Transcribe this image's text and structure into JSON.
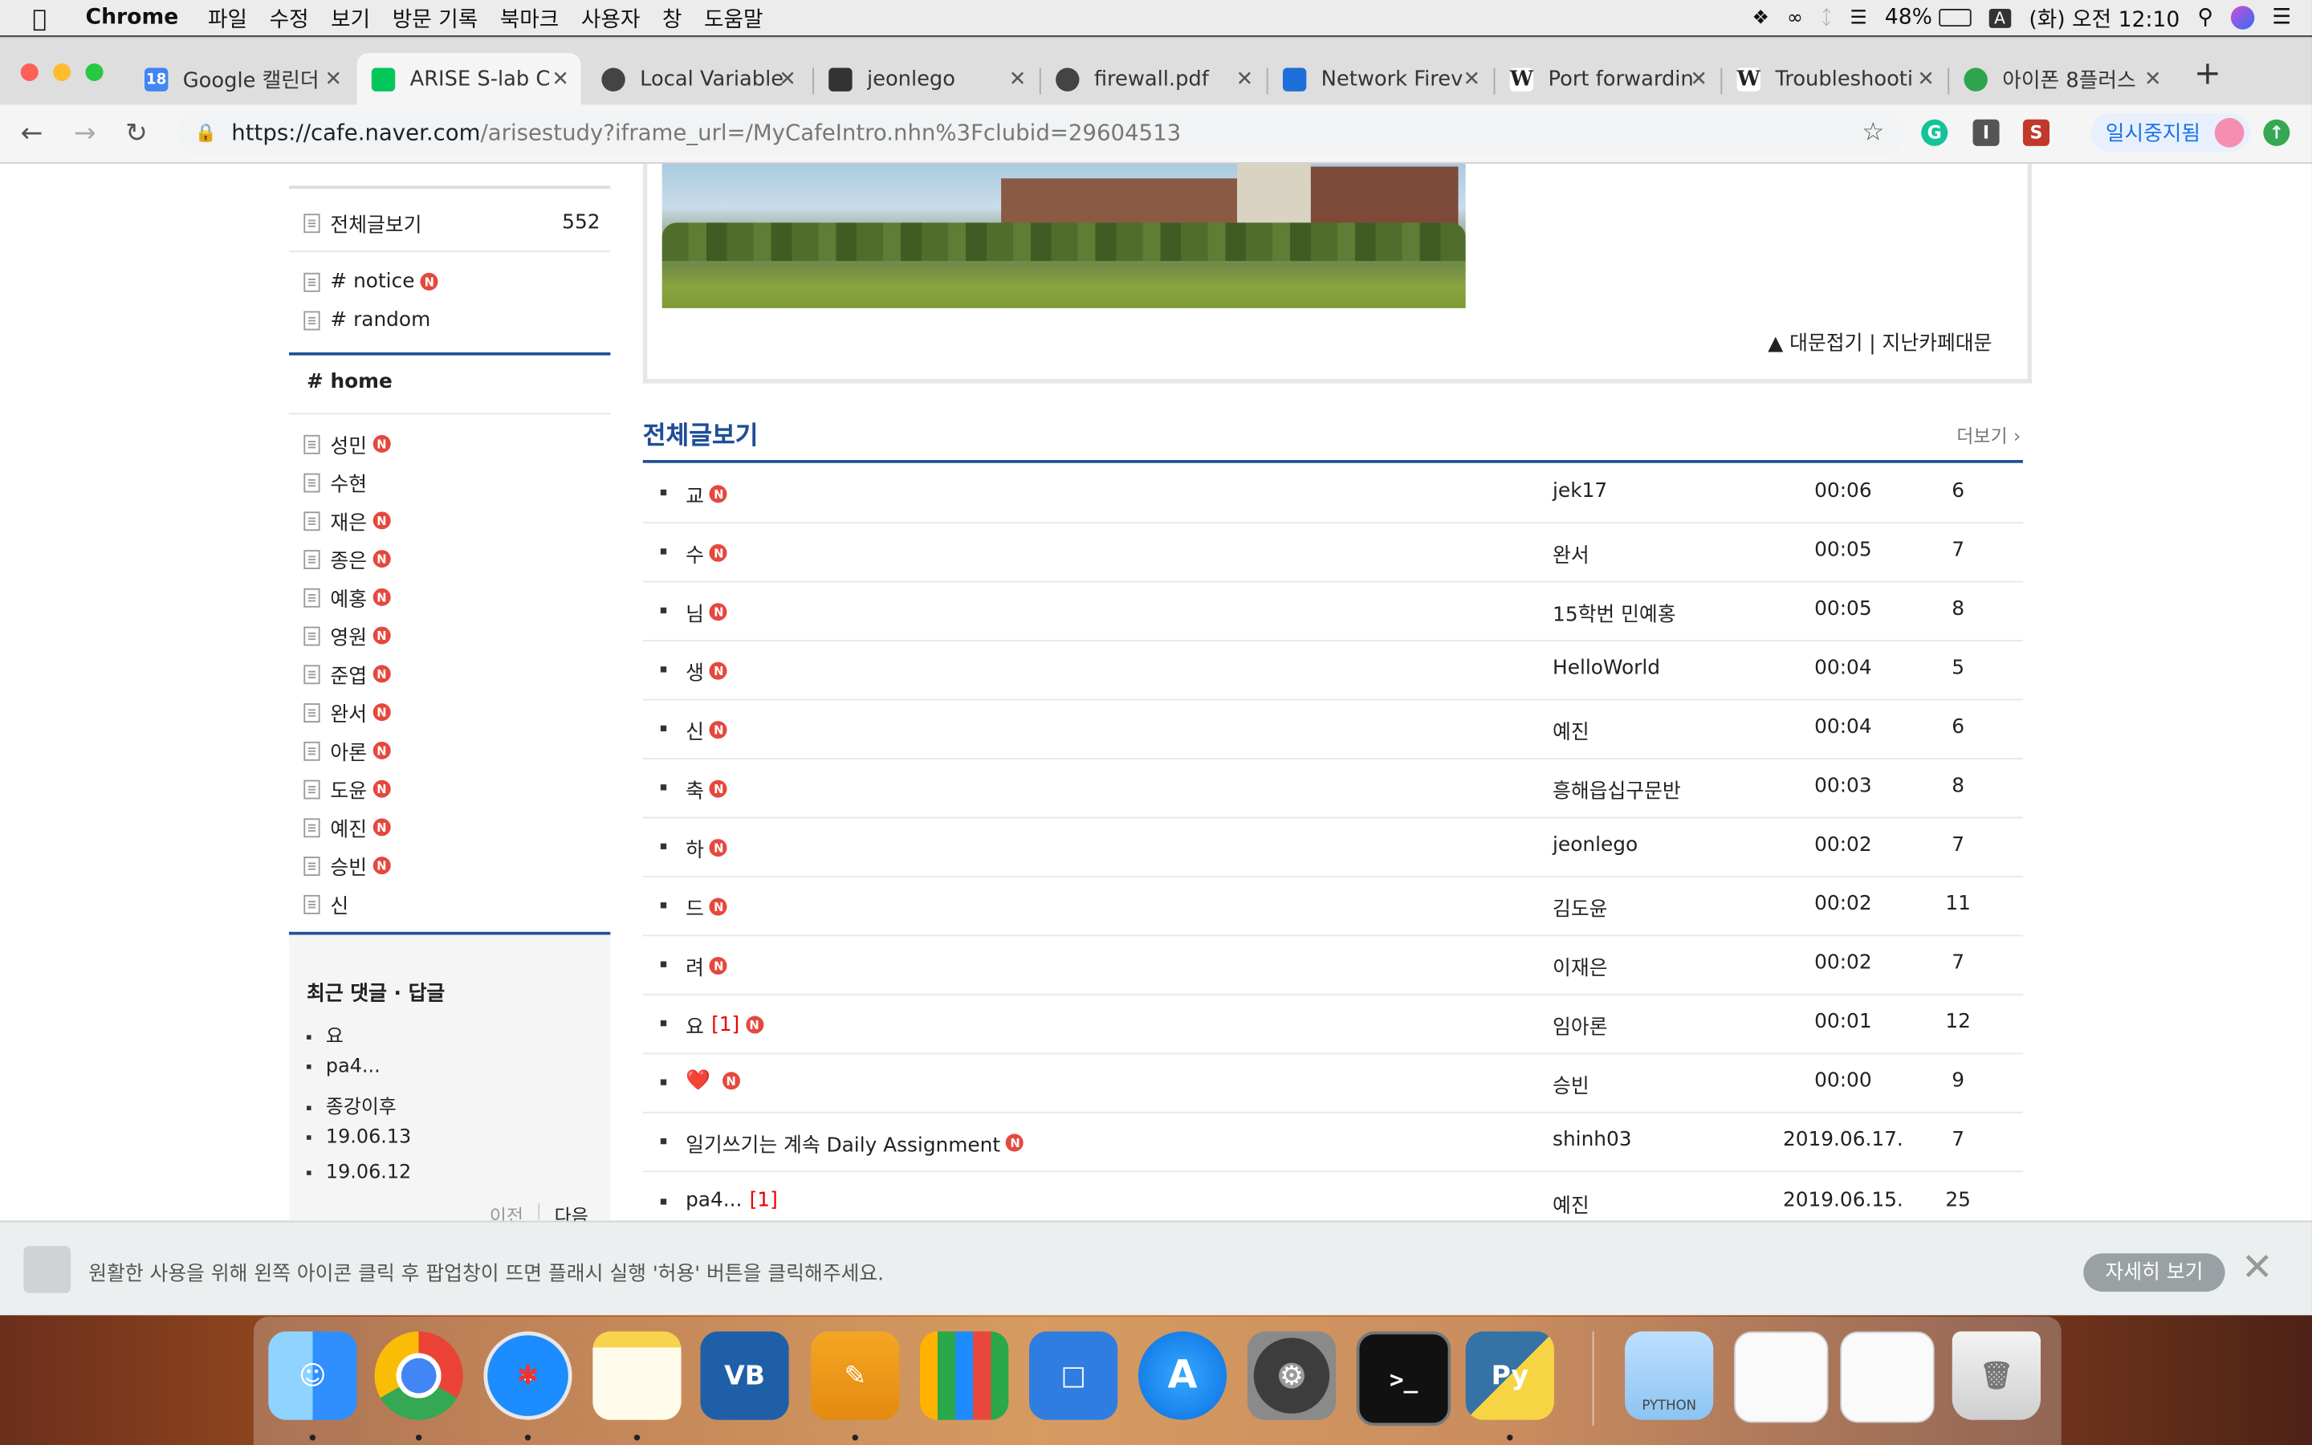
{
  "menubar": {
    "app": "Chrome",
    "items": [
      "파일",
      "수정",
      "보기",
      "방문 기록",
      "북마크",
      "사용자",
      "창",
      "도움말"
    ],
    "battery": "48%",
    "input_source": "A",
    "clock": "(화) 오전 12:10"
  },
  "tabs": [
    {
      "title": "Google 캘린더",
      "favicon_text": "18",
      "color": "#4285f4"
    },
    {
      "title": "ARISE S-lab C",
      "favicon_text": "",
      "color": "#03c75a"
    },
    {
      "title": "Local Variable",
      "favicon_text": "",
      "color": "#444444"
    },
    {
      "title": "jeonlego",
      "favicon_text": "",
      "color": "#333333"
    },
    {
      "title": "firewall.pdf",
      "favicon_text": "",
      "color": "#444444"
    },
    {
      "title": "Network Firev",
      "favicon_text": "",
      "color": "#1e6fd9"
    },
    {
      "title": "Port forwardin",
      "favicon_text": "W",
      "color": "#222222"
    },
    {
      "title": "Troubleshooti",
      "favicon_text": "W",
      "color": "#222222"
    },
    {
      "title": "아이폰 8플러스",
      "favicon_text": "",
      "color": "#2ea44f"
    }
  ],
  "address": {
    "domain": "https://cafe.naver.com",
    "path": "/arisestudy?iframe_url=/MyCafeIntro.nhn%3Fclubid=29604513"
  },
  "extensions": [
    "G",
    "I",
    "S"
  ],
  "pause_label": "일시중지됨",
  "sidebar": {
    "all_posts_label": "전체글보기",
    "all_posts_count": "552",
    "boards": [
      "# notice",
      "# random"
    ],
    "home_label": "# home",
    "members": [
      {
        "name": "성민",
        "new": true
      },
      {
        "name": "수현",
        "new": false
      },
      {
        "name": "재은",
        "new": true
      },
      {
        "name": "종은",
        "new": true
      },
      {
        "name": "예홍",
        "new": true
      },
      {
        "name": "영원",
        "new": true
      },
      {
        "name": "준엽",
        "new": true
      },
      {
        "name": "완서",
        "new": true
      },
      {
        "name": "아론",
        "new": true
      },
      {
        "name": "도윤",
        "new": true
      },
      {
        "name": "예진",
        "new": true
      },
      {
        "name": "승빈",
        "new": true
      },
      {
        "name": "신",
        "new": false
      }
    ],
    "recent_title": "최근 댓글 · 답글",
    "recent": [
      "요",
      "pa4...",
      "종강이후",
      "19.06.13",
      "19.06.12"
    ],
    "prev": "이전",
    "next": "다음"
  },
  "banner_links": "▲ 대문접기 | 지난카페대문",
  "posts_section": {
    "title": "전체글보기",
    "more": "더보기",
    "new_badge": "N",
    "rows": [
      {
        "title": "교",
        "comments": "",
        "new": true,
        "author": "jek17",
        "time": "00:06",
        "views": "6"
      },
      {
        "title": "수",
        "comments": "",
        "new": true,
        "author": "완서",
        "time": "00:05",
        "views": "7"
      },
      {
        "title": "님",
        "comments": "",
        "new": true,
        "author": "15학번 민예홍",
        "time": "00:05",
        "views": "8"
      },
      {
        "title": "생",
        "comments": "",
        "new": true,
        "author": "HelloWorld",
        "time": "00:04",
        "views": "5"
      },
      {
        "title": "신",
        "comments": "",
        "new": true,
        "author": "예진",
        "time": "00:04",
        "views": "6"
      },
      {
        "title": "축",
        "comments": "",
        "new": true,
        "author": "흥해읍십구문반",
        "time": "00:03",
        "views": "8"
      },
      {
        "title": "하",
        "comments": "",
        "new": true,
        "author": "jeonlego",
        "time": "00:02",
        "views": "7"
      },
      {
        "title": "드",
        "comments": "",
        "new": true,
        "author": "김도윤",
        "time": "00:02",
        "views": "11"
      },
      {
        "title": "려",
        "comments": "",
        "new": true,
        "author": "이재은",
        "time": "00:02",
        "views": "7"
      },
      {
        "title": "요",
        "comments": "[1]",
        "new": true,
        "author": "임아론",
        "time": "00:01",
        "views": "12"
      },
      {
        "title": "❤️",
        "comments": "",
        "new": true,
        "author": "승빈",
        "time": "00:00",
        "views": "9"
      },
      {
        "title": "일기쓰기는 계속 Daily Assignment",
        "comments": "",
        "new": true,
        "author": "shinh03",
        "time": "2019.06.17.",
        "views": "7"
      },
      {
        "title": "pa4...",
        "comments": "[1]",
        "new": false,
        "author": "예진",
        "time": "2019.06.15.",
        "views": "25"
      }
    ]
  },
  "flash_notice": {
    "text": "원활한 사용을 위해 왼쪽 아이콘 클릭 후 팝업창이 뜨면 플래시 실행 '허용' 버튼을 클릭해주세요.",
    "detail_button": "자세히 보기"
  },
  "dock": {
    "apps": [
      "finder",
      "chrome",
      "safari",
      "notes",
      "virtualbox",
      "pages",
      "numbers",
      "keynote",
      "app-store",
      "system-preferences",
      "terminal",
      "python-launcher",
      "python-folder",
      "document-1",
      "document-2",
      "trash"
    ],
    "python_folder_label": "PYTHON"
  }
}
